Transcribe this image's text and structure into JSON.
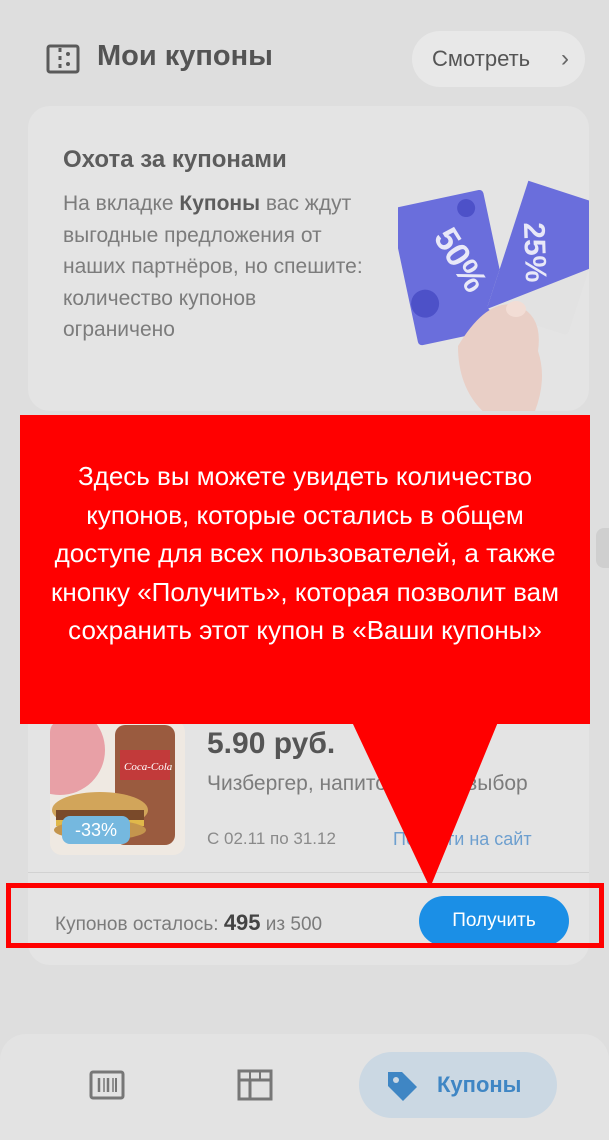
{
  "header": {
    "title": "Мои купоны",
    "view_button": "Смотреть"
  },
  "promo": {
    "title": "Охота за купонами",
    "text_before": "На вкладке ",
    "text_bold": "Купоны",
    "text_after": " вас ждут выгодные предложения от наших партнёров, но спешите: количество купонов ограничено",
    "art_label_1": "50%",
    "art_label_2": "25%"
  },
  "callout": {
    "text": "Здесь вы можете увидеть количество купонов, которые остались в общем доступе для всех пользователей, а также кнопку «Получить», которая позволит вам сохранить этот купон в «Ваши купоны»"
  },
  "coupon": {
    "discount": "-33%",
    "price": "5.90 руб.",
    "description": "Чизбергер, напиток 0,4 на выбор",
    "dates": "С 02.11 по 31.12",
    "link": "Перейти на сайт",
    "remaining_label": "Купонов осталось: ",
    "remaining_count": "495",
    "remaining_sep": " из ",
    "remaining_total": "500",
    "get_button": "Получить",
    "brand_text": "Coca-Cola"
  },
  "nav": {
    "active_label": "Купоны",
    "icons": [
      "barcode-card-icon",
      "store-icon",
      "tag-icon"
    ]
  },
  "colors": {
    "overlay_red": "#ff0000",
    "accent_blue": "#1b8fe6",
    "promo_purple": "#5b5fe0"
  }
}
